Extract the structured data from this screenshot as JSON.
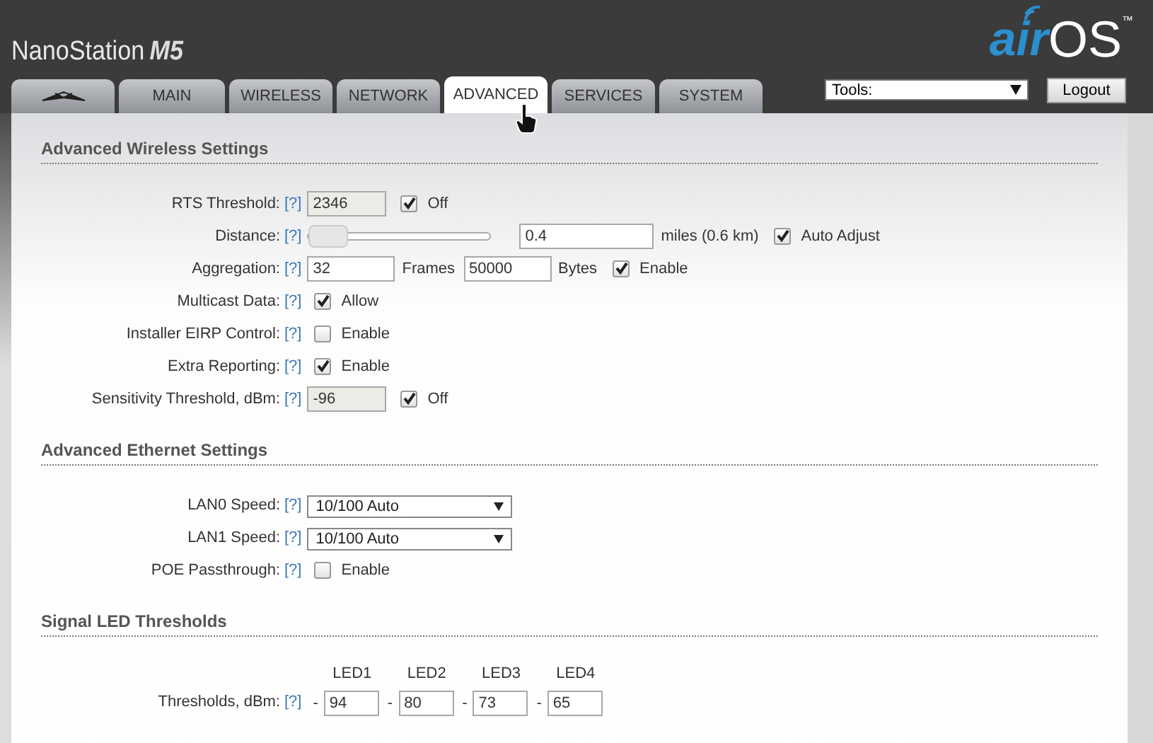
{
  "header": {
    "product": "NanoStation",
    "model": "M5",
    "brand_left": "air",
    "brand_right": "OS",
    "trademark": "™"
  },
  "tabs": [
    {
      "kind": "logo",
      "selected": false
    },
    {
      "kind": "text",
      "label": "MAIN",
      "selected": false
    },
    {
      "kind": "text",
      "label": "WIRELESS",
      "selected": false
    },
    {
      "kind": "text",
      "label": "NETWORK",
      "selected": false
    },
    {
      "kind": "text",
      "label": "ADVANCED",
      "selected": true
    },
    {
      "kind": "text",
      "label": "SERVICES",
      "selected": false
    },
    {
      "kind": "text",
      "label": "SYSTEM",
      "selected": false
    }
  ],
  "tools": {
    "value": "Tools:"
  },
  "logout": "Logout",
  "sections": [
    {
      "title": "Advanced Wireless Settings",
      "rows": [
        {
          "kind": "plain",
          "label": "RTS Threshold:",
          "help": "[?]",
          "controls": [
            {
              "kind": "input",
              "value": "2346",
              "disabled": true
            },
            {
              "kind": "check",
              "checked": true,
              "label": "Off"
            }
          ]
        },
        {
          "kind": "distance",
          "label": "Distance:",
          "help": "[?]",
          "controls": [
            {
              "kind": "slider",
              "level": 0.0
            },
            {
              "kind": "input",
              "value": "0.4",
              "disabled": false
            },
            {
              "kind": "text",
              "text": "miles (0.6 km)"
            },
            {
              "kind": "check",
              "checked": true,
              "label": "Auto Adjust"
            }
          ]
        },
        {
          "kind": "plain",
          "label": "Aggregation:",
          "help": "[?]",
          "controls": [
            {
              "kind": "input",
              "value": "32",
              "disabled": false
            },
            {
              "kind": "text",
              "text": "Frames"
            },
            {
              "kind": "input",
              "value": "50000",
              "disabled": false
            },
            {
              "kind": "text",
              "text": "Bytes"
            },
            {
              "kind": "check",
              "checked": true,
              "label": "Enable"
            }
          ]
        },
        {
          "kind": "plain",
          "label": "Multicast Data:",
          "help": "[?]",
          "controls": [
            {
              "kind": "check",
              "checked": true,
              "label": "Allow"
            }
          ]
        },
        {
          "kind": "plain",
          "label": "Installer EIRP Control:",
          "help": "[?]",
          "controls": [
            {
              "kind": "check",
              "checked": false,
              "label": "Enable"
            }
          ]
        },
        {
          "kind": "plain",
          "label": "Extra Reporting:",
          "help": "[?]",
          "controls": [
            {
              "kind": "check",
              "checked": true,
              "label": "Enable"
            }
          ]
        },
        {
          "kind": "plain",
          "label": "Sensitivity Threshold, dBm:",
          "help": "[?]",
          "controls": [
            {
              "kind": "input",
              "value": "-96",
              "disabled": true
            },
            {
              "kind": "check",
              "checked": true,
              "label": "Off"
            }
          ]
        }
      ]
    },
    {
      "title": "Advanced Ethernet Settings",
      "rows": [
        {
          "kind": "plain",
          "label": "LAN0 Speed:",
          "help": "[?]",
          "controls": [
            {
              "kind": "select",
              "value": "10/100 Auto"
            }
          ]
        },
        {
          "kind": "plain",
          "label": "LAN1 Speed:",
          "help": "[?]",
          "controls": [
            {
              "kind": "select",
              "value": "10/100 Auto"
            }
          ]
        },
        {
          "kind": "plain",
          "label": "POE Passthrough:",
          "help": "[?]",
          "controls": [
            {
              "kind": "check",
              "checked": false,
              "label": "Enable"
            }
          ]
        }
      ]
    },
    {
      "title": "Signal LED Thresholds",
      "rows": [
        {
          "kind": "led",
          "label": "Thresholds, dBm:",
          "help": "[?]",
          "controls": [
            {
              "kind": "led",
              "header": "LED1",
              "prefix": "-",
              "value": "94"
            },
            {
              "kind": "led",
              "header": "LED2",
              "prefix": "-",
              "value": "80"
            },
            {
              "kind": "led",
              "header": "LED3",
              "prefix": "-",
              "value": "73"
            },
            {
              "kind": "led",
              "header": "LED4",
              "prefix": "-",
              "value": "65"
            }
          ]
        }
      ]
    }
  ]
}
